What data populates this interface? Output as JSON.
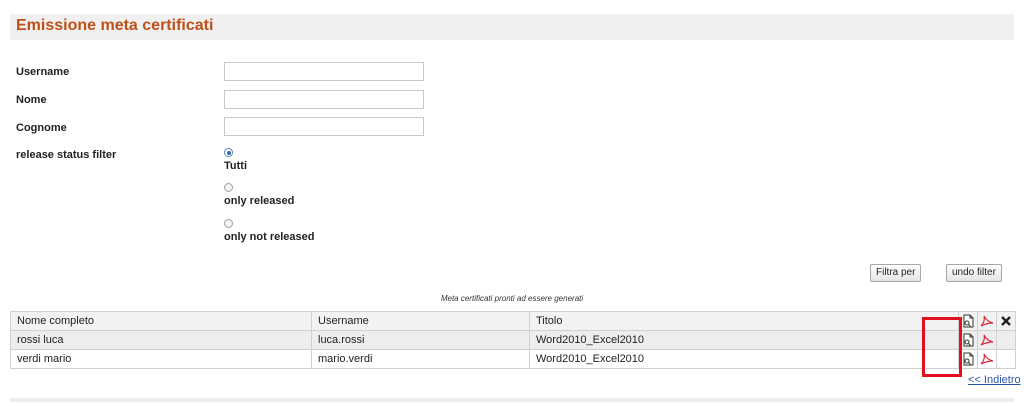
{
  "header": {
    "title": "Emissione meta certificati"
  },
  "form": {
    "username_label": "Username",
    "nome_label": "Nome",
    "cognome_label": "Cognome",
    "status_label": "release status filter",
    "username_value": "",
    "nome_value": "",
    "cognome_value": "",
    "radios": [
      {
        "label": "Tutti",
        "checked": true
      },
      {
        "label": "only released",
        "checked": false
      },
      {
        "label": "only not released",
        "checked": false
      }
    ]
  },
  "buttons": {
    "filter": "Filtra per",
    "undo": "undo filter"
  },
  "table": {
    "caption": "Meta certificati pronti ad essere generati",
    "headers": [
      "Nome completo",
      "Username",
      "Titolo"
    ],
    "rows": [
      {
        "nome": "rossi luca",
        "username": "luca.rossi",
        "titolo": "Word2010_Excel2010"
      },
      {
        "nome": "verdi mario",
        "username": "mario.verdi",
        "titolo": "Word2010_Excel2010"
      }
    ]
  },
  "icons": {
    "generate": "document-generate-icon",
    "pdf": "pdf-icon",
    "delete": "close-icon",
    "accent": "#c0501a",
    "pdf_color": "#d8283a"
  },
  "back_link": "<< Indietro"
}
